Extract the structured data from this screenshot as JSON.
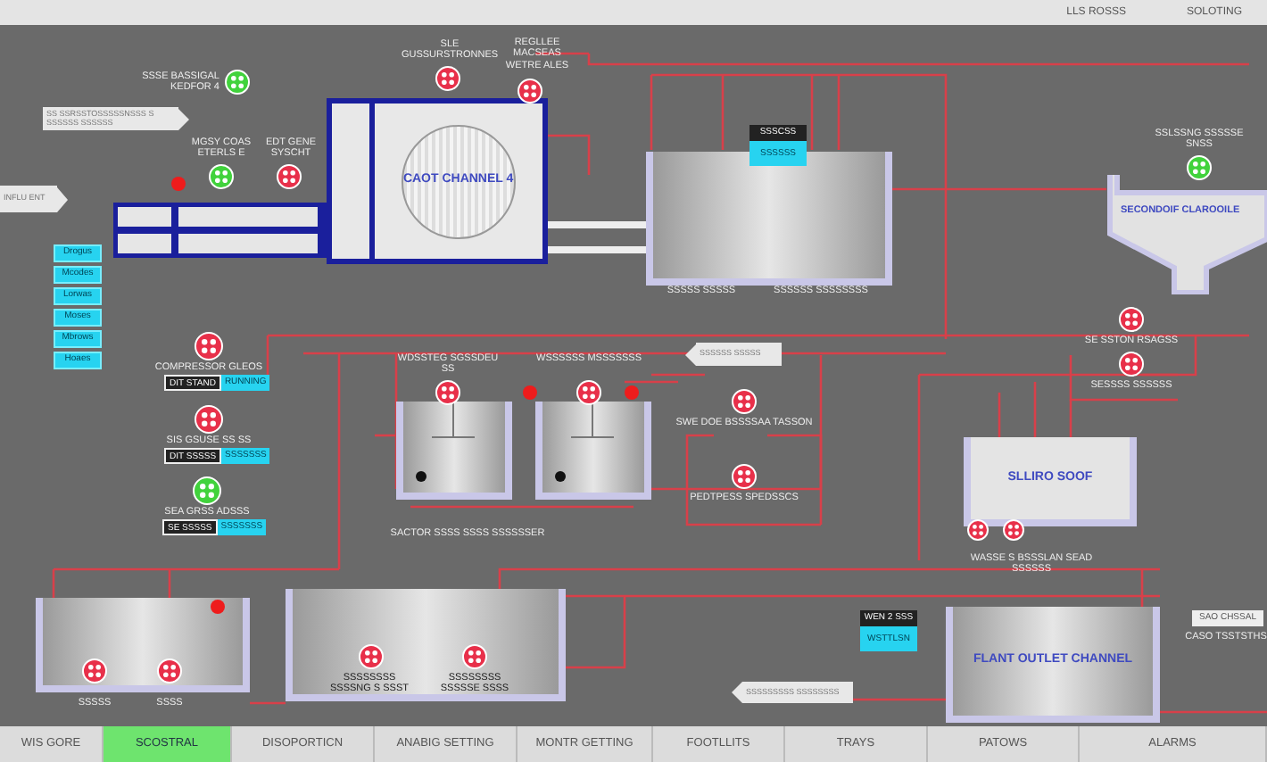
{
  "header": {
    "texts": [
      "LLS ROSSS",
      "SOLOTING"
    ]
  },
  "flow_labels": [
    {
      "text": "INFLU ENT",
      "kind": "right"
    },
    {
      "text": "SS SSRSSTOSSSSSNSSS S SSSSSS SSSSSS",
      "kind": "right"
    },
    {
      "text": "SSSSSS SSSSS",
      "kind": "left"
    },
    {
      "text": "SSSSSSSSS SSSSSSSS",
      "kind": "left"
    }
  ],
  "selector_buttons": [
    "Drogus",
    "Mcodes",
    "Lorwas",
    "Moses",
    "Mbrows",
    "Hoaes"
  ],
  "pumps": [
    {
      "label": "SSSE BASSIGAL KEDFOR 4",
      "running": true
    },
    {
      "label": "SLE GUSSURSTRONNES",
      "running": false
    },
    {
      "label": "REGLLEE MACSEAS WETRE ALES",
      "running": false
    },
    {
      "label": "MGSY COAS ETERLS E",
      "running": true
    },
    {
      "label": "EDT GENE SYSCHT",
      "running": false
    },
    {
      "label": "WDSSTEG SGSSDEU SS",
      "running": false
    },
    {
      "label": "WSSSSSS MSSSSSSS",
      "running": false
    },
    {
      "label": "SWE DOE BSSSSAA TASSON",
      "running": false
    },
    {
      "label": "PEDTPESS SPEDSSCS",
      "running": false
    },
    {
      "label": "SE SSTON RSAGSS",
      "running": false
    },
    {
      "label": "SESSSS SSSSSS",
      "running": false
    },
    {
      "label": "SSSSSSSS SSSSNG S SSST",
      "running": false
    },
    {
      "label": "SSSSSSSS SSSSSE SSSS",
      "running": false
    },
    {
      "label": "SSSSS",
      "running": false
    },
    {
      "label": "SSSS",
      "running": false
    },
    {
      "running": false
    },
    {
      "running": false
    },
    {
      "label": "SSLSSNG SSSSSE SNSS",
      "running": true
    }
  ],
  "status_pumps": [
    {
      "label": "COMPRESSOR GLEOS",
      "mode": "DIT STAND",
      "state": "RUNNING",
      "running": false
    },
    {
      "label": "SIS GSUSE SS SS",
      "mode": "DIT SSSSS",
      "state": "SSSSSSS",
      "running": false
    },
    {
      "label": "SEA GRSS ADSSS",
      "mode": "SE SSSSS",
      "state": "SSSSSSS",
      "running": true
    }
  ],
  "alarms": [
    {
      "active": true
    },
    {
      "active": true
    },
    {
      "active": true
    },
    {
      "active": true
    }
  ],
  "tanks": [
    {
      "kind": "channel",
      "label": "CAOT CHANNEL 4"
    },
    {
      "kind": "basin",
      "captions": [
        "SSSSS SSSSS",
        "SSSSSS SSSSSSSS"
      ]
    },
    {
      "kind": "clarifier",
      "label": "SECONDOIF CLAROOILE"
    },
    {
      "kind": "mixer"
    },
    {
      "kind": "mixer",
      "captions": [
        "SACTOR SSSS SSSS SSSSSSER"
      ]
    },
    {
      "kind": "sump",
      "label": "SLLIRO SOOF",
      "captions": [
        "WASSE S BSSSLAN SEAD SSSSSS"
      ]
    },
    {
      "kind": "basin"
    },
    {
      "kind": "basin"
    },
    {
      "kind": "basin",
      "label": "FLANT OUTLET CHANNEL"
    }
  ],
  "displays": [
    {
      "title": "SSSCSS",
      "value": "SSSSSS"
    },
    {
      "title": "WEN 2 SSS",
      "value": "WSTTLSN"
    }
  ],
  "note": {
    "title": "SAO CHSSAL",
    "text": "CASO TSSTSTHS"
  },
  "tabs": [
    {
      "label": "WIS GORE",
      "selected": false
    },
    {
      "label": "SCOSTRAL",
      "selected": true
    },
    {
      "label": "DISOPORTICN",
      "selected": false
    },
    {
      "label": "ANABIG SETTING",
      "selected": false
    },
    {
      "label": "MONTR GETTING",
      "selected": false
    },
    {
      "label": "FOOTLLITS",
      "selected": false
    },
    {
      "label": "TRAYS",
      "selected": false
    },
    {
      "label": "PATOWS",
      "selected": false
    },
    {
      "label": "ALARMS",
      "selected": false
    }
  ]
}
